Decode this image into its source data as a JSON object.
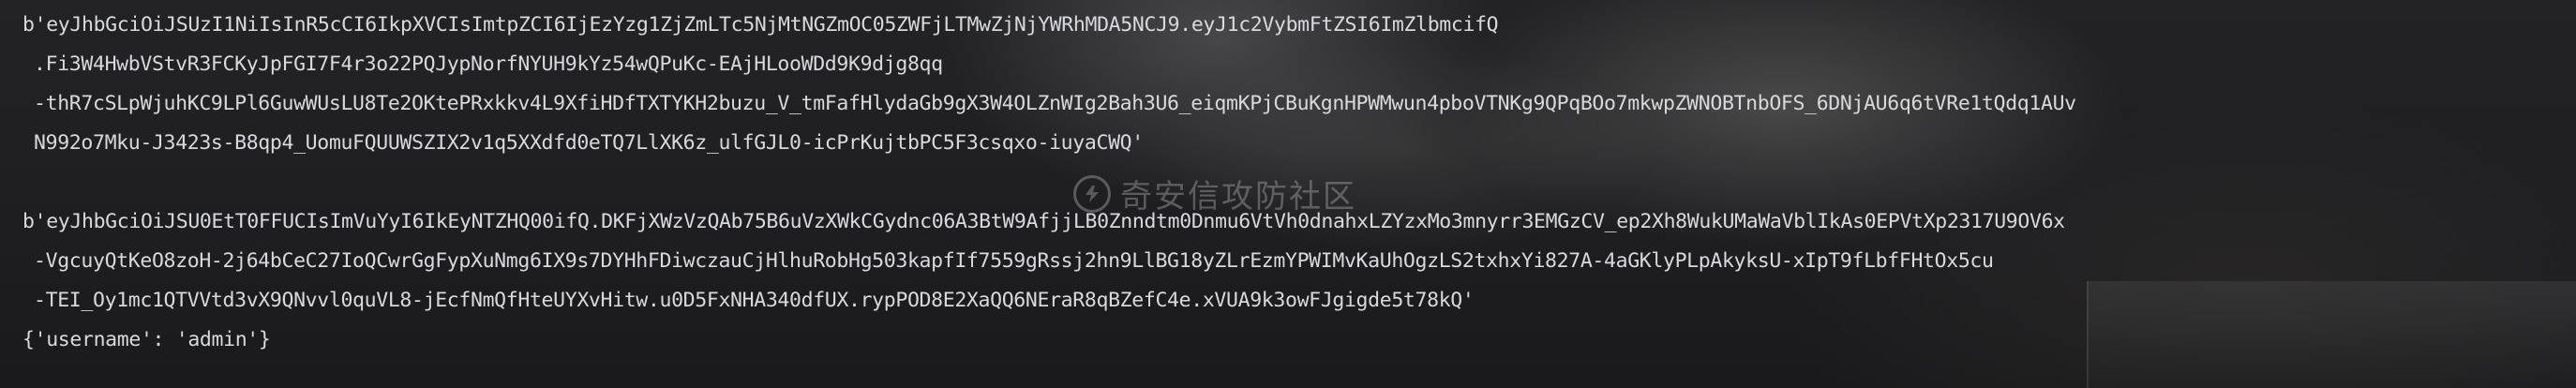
{
  "terminal": {
    "lines": [
      "b'eyJhbGciOiJSUzI1NiIsInR5cCI6IkpXVCIsImtpZCI6IjEzYzg1ZjZmLTc5NjMtNGZmOC05ZWFjLTMwZjNjYWRhMDA5NCJ9.eyJ1c2VybmFtZSI6ImZlbmcifQ",
      ".Fi3W4HwbVStvR3FCKyJpFGI7F4r3o22PQJypNorfNYUH9kYz54wQPuKc-EAjHLooWDd9K9djg8qq",
      "-thR7cSLpWjuhKC9LPl6GuwWUsLU8Te2OKtePRxkkv4L9XfiHDfTXTYKH2buzu_V_tmFafHlydaGb9gX3W4OLZnWIg2Bah3U6_eiqmKPjCBuKgnHPWMwun4pboVTNKg9QPqBOo7mkwpZWNOBTnbOFS_6DNjAU6q6tVRe1tQdq1AUv",
      "N992o7Mku-J3423s-B8qp4_UomuFQUUWSZIX2v1q5XXdfd0eTQ7LlXK6z_ulfGJL0-icPrKujtbPC5F3csqxo-iuyaCWQ'",
      "b'eyJhbGciOiJSU0EtT0FFUCIsImVuYyI6IkEyNTZHQ00ifQ.DKFjXWzVzQAb75B6uVzXWkCGydnc06A3BtW9AfjjLB0Znndtm0Dnmu6VtVh0dnahxLZYzxMo3mnyrr3EMGzCV_ep2Xh8WukUMaWaVblIkAs0EPVtXp2317U9OV6x",
      "-VgcuyQtKeO8zoH-2j64bCeC27IoQCwrGgFypXuNmg6IX9s7DYHhFDiwczauCjHlhuRobHg503kapfIf7559gRssj2hn9LlBG18yZLrEzmYPWIMvKaUhOgzLS2txhxYi827A-4aGKlyPLpAkyksU-xIpT9fLbfFHtOx5cu",
      "-TEI_Oy1mc1QTVVtd3vX9QNvvl0quVL8-jEcfNmQfHteUYXvHitw.u0D5FxNHA340dfUX.rypPOD8E2XaQQ6NEraR8qBZefC4e.xVUA9k3owFJgigde5t78kQ'",
      "{'username': 'admin'}"
    ]
  },
  "watermark": {
    "text": "奇安信攻防社区",
    "icon": "shield-logo-icon"
  },
  "colors": {
    "text": "#d7d9dc",
    "background": "#1d1d20"
  }
}
